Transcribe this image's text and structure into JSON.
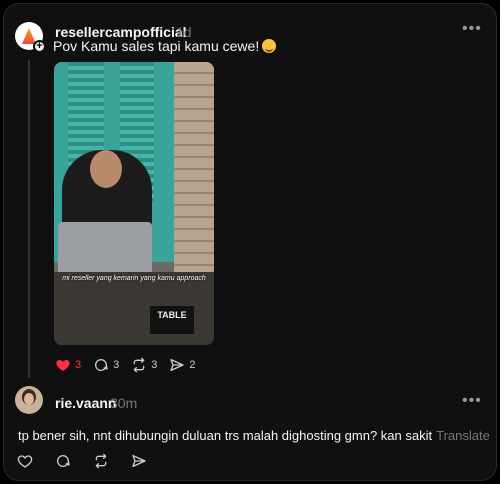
{
  "post": {
    "username": "resellercampofficial",
    "time": "1d",
    "caption": "Pov Kamu sales tapi kamu cewe!",
    "media_overlay_text": "mi reseller yang kemarin yang kamu approach",
    "media_sign_text": "TABLE",
    "likes": "3",
    "comments": "3",
    "reposts": "3",
    "shares": "2",
    "liked": true
  },
  "reply": {
    "username": "rie.vaann",
    "time": "30m",
    "text": "tp bener sih, nnt dihubungin duluan trs malah dighosting gmn? kan sakit",
    "translate_label": "Translate"
  },
  "colors": {
    "like_red": "#ff3040",
    "background": "#101010",
    "muted": "#777777"
  }
}
